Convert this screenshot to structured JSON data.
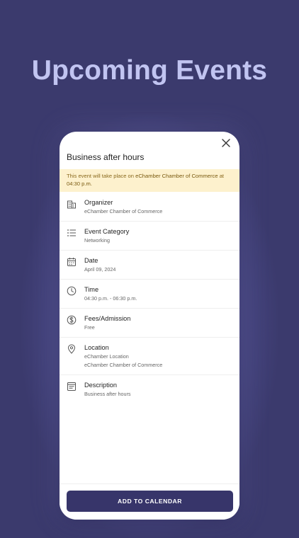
{
  "hero": {
    "title": "Upcoming Events"
  },
  "modal": {
    "title": "Business after hours",
    "notice": {
      "prefix": "This event will take place on ",
      "organizer": "eChamber Chamber of Commerce",
      "middle": " at ",
      "time": "04:30 p.m."
    },
    "details": [
      {
        "icon": "building-icon",
        "label": "Organizer",
        "value": "eChamber Chamber of Commerce"
      },
      {
        "icon": "list-icon",
        "label": "Event Category",
        "value": "Networking"
      },
      {
        "icon": "calendar-icon",
        "label": "Date",
        "value": "April 09, 2024"
      },
      {
        "icon": "clock-icon",
        "label": "Time",
        "value": "04:30 p.m. - 06:30 p.m."
      },
      {
        "icon": "dollar-icon",
        "label": "Fees/Admission",
        "value": "Free"
      },
      {
        "icon": "location-pin-icon",
        "label": "Location",
        "value": "eChamber Location",
        "value2": "eChamber Chamber of Commerce"
      },
      {
        "icon": "document-icon",
        "label": "Description",
        "value": "Business after hours"
      }
    ],
    "cta_label": "ADD TO CALENDAR"
  },
  "colors": {
    "background": "#3b3a6d",
    "hero_text": "#c1c4f1",
    "button": "#37356a",
    "notice_bg": "#fdf1cd"
  }
}
